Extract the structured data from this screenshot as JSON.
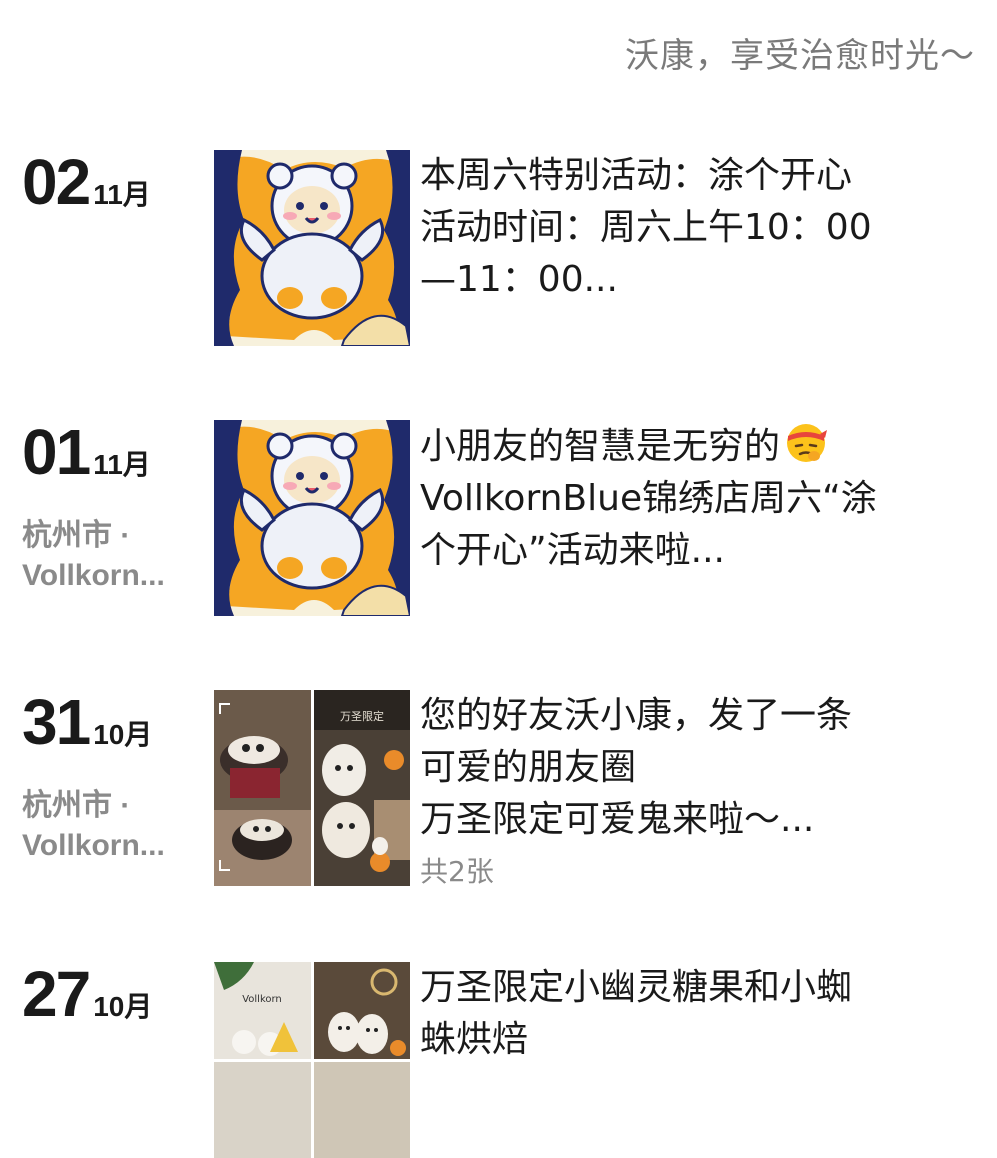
{
  "signature": "沃康，享受治愈时光～",
  "posts": [
    {
      "day": "02",
      "month": "11月",
      "location_line1": "",
      "location_line2": "",
      "lines": [
        "本周六特别活动：涂个开心",
        "活动时间：周六上午10：00",
        "—11：00..."
      ],
      "image_count": "",
      "thumb": "bear-illustration"
    },
    {
      "day": "01",
      "month": "11月",
      "location_line1": "杭州市 ·",
      "location_line2": "Vollkorn...",
      "lines": [
        "小朋友的智慧是无穷的",
        "VollkornBlue锦绣店周六“涂",
        "个开心”活动来啦..."
      ],
      "emoji": "thinking-headband-emoji",
      "image_count": "",
      "thumb": "bear-illustration"
    },
    {
      "day": "31",
      "month": "10月",
      "location_line1": "杭州市 ·",
      "location_line2": "Vollkorn...",
      "lines": [
        "您的好友沃小康，发了一条",
        "可爱的朋友圈",
        "万圣限定可爱鬼来啦～..."
      ],
      "image_count": "共2张",
      "thumb": "halloween-cakes",
      "thumb_caption": "万圣限定"
    },
    {
      "day": "27",
      "month": "10月",
      "location_line1": "",
      "location_line2": "",
      "lines": [
        "万圣限定小幽灵糖果和小蜘",
        "蛛烘焙"
      ],
      "image_count": "",
      "thumb": "ghost-candies",
      "thumb_caption": "Vollkorn"
    }
  ],
  "colors": {
    "text": "#1a1a1a",
    "muted": "#8a8a8a",
    "bear_orange": "#f5a623",
    "bear_navy": "#1f2a6b"
  }
}
